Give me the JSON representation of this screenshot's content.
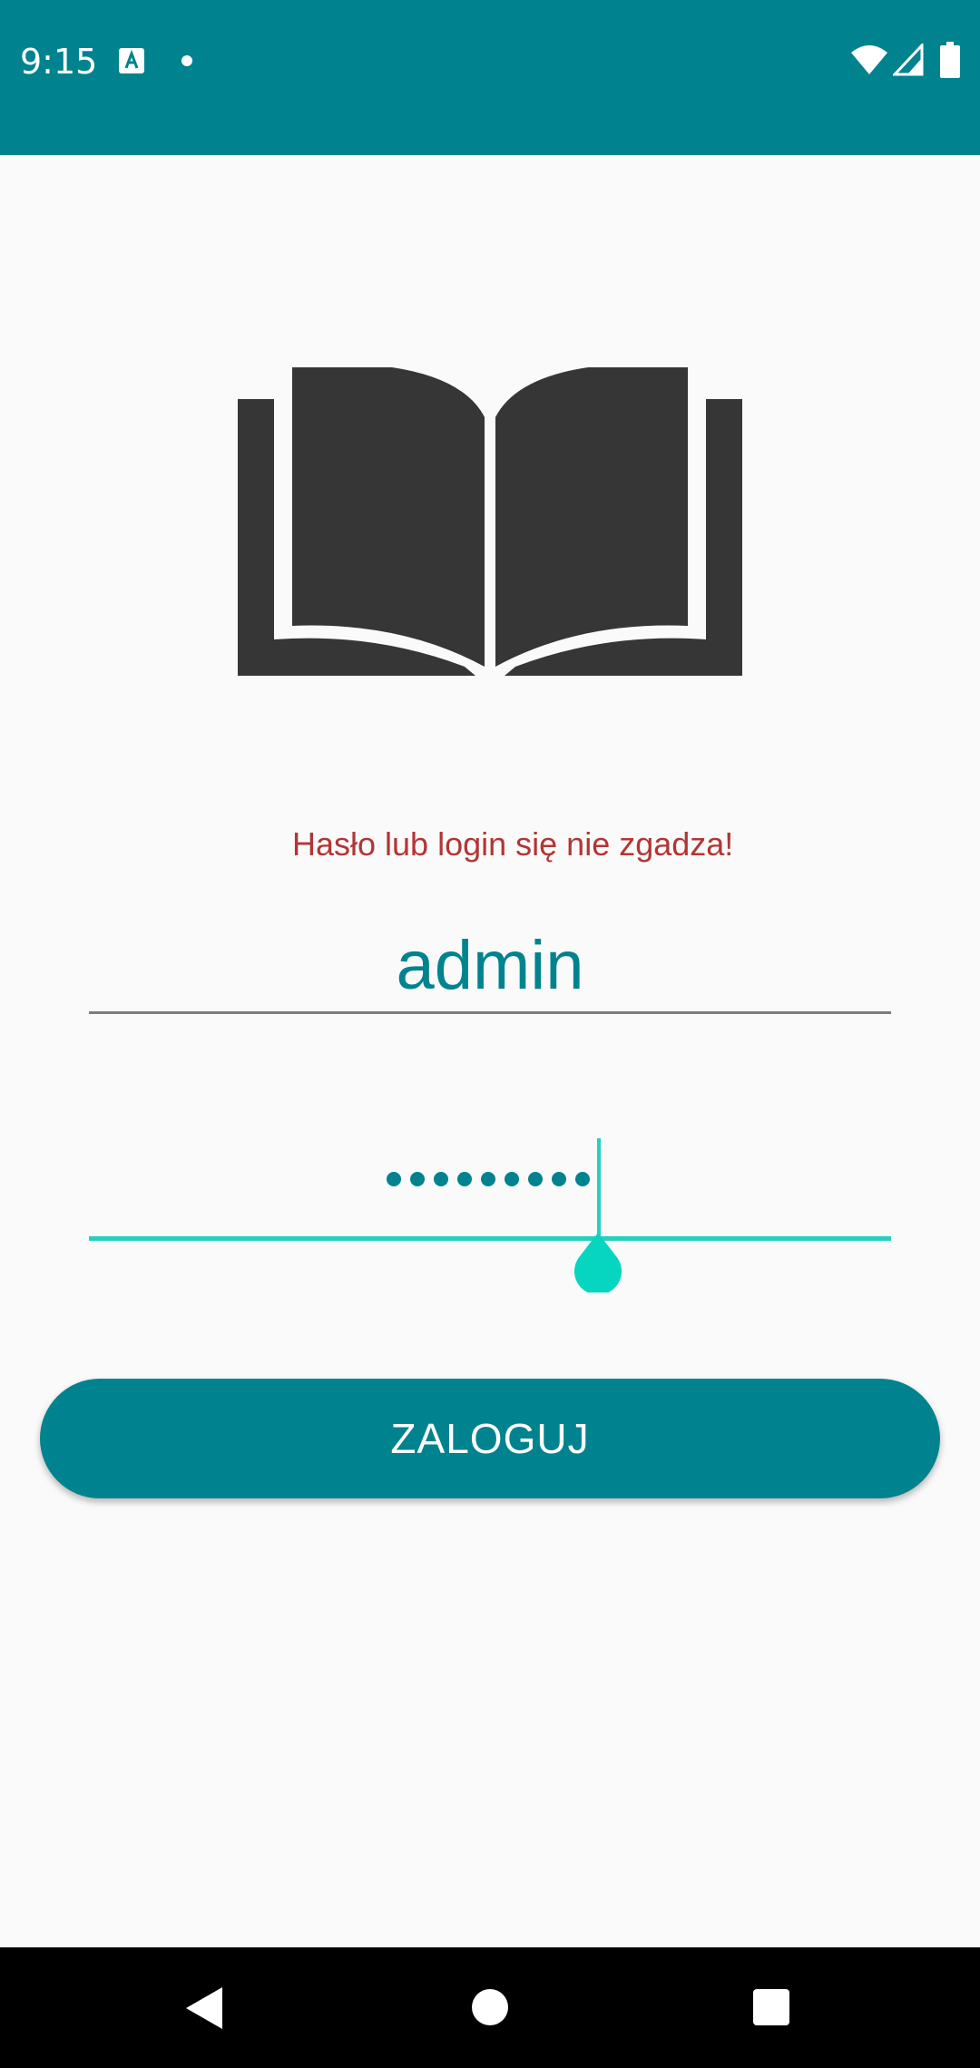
{
  "status_bar": {
    "time": "9:15",
    "icons": [
      "text-a-notification-icon",
      "notification-dot-icon",
      "wifi-icon",
      "cell-signal-icon",
      "battery-icon"
    ]
  },
  "logo": {
    "icon": "open-book-icon"
  },
  "login_form": {
    "error_message": "Hasło lub login się nie zgadza!",
    "login_value": "admin",
    "password_mask_count": 9,
    "submit_label": "ZALOGUJ"
  },
  "nav_bar": {
    "icons": [
      "back-icon",
      "home-icon",
      "recents-icon"
    ]
  },
  "colors": {
    "primary": "#00838f",
    "accent": "#26d0be",
    "error": "#b23535",
    "background": "#fafafa"
  }
}
